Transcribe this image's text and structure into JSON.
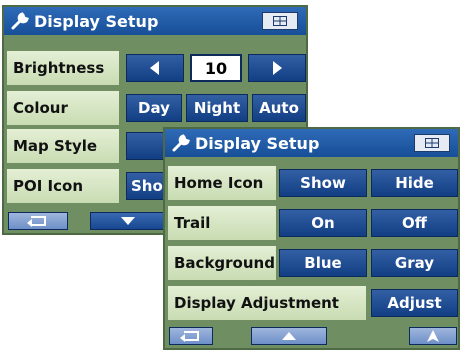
{
  "panel_back": {
    "title": "Display Setup",
    "brightness": {
      "label": "Brightness",
      "value": "10"
    },
    "colour": {
      "label": "Colour",
      "options": [
        "Day",
        "Night",
        "Auto"
      ]
    },
    "map_style": {
      "label": "Map Style"
    },
    "poi_icon": {
      "label": "POI Icon",
      "option_partial": "Sho"
    }
  },
  "panel_front": {
    "title": "Display Setup",
    "home_icon": {
      "label": "Home Icon",
      "options": [
        "Show",
        "Hide"
      ]
    },
    "trail": {
      "label": "Trail",
      "options": [
        "On",
        "Off"
      ]
    },
    "background": {
      "label": "Background",
      "options": [
        "Blue",
        "Gray"
      ]
    },
    "display_adjustment": {
      "label": "Display Adjustment",
      "button": "Adjust"
    }
  },
  "icons": {
    "title": "wrench-icon",
    "keyboard": "keyboard-icon",
    "back": "back-arrow-icon",
    "scroll_down": "chevron-down-icon",
    "scroll_up": "chevron-up-icon",
    "decrease": "arrow-left-icon",
    "increase": "arrow-right-icon"
  },
  "colors": {
    "title_bar": "#1f5aa6",
    "button": "#1f4f96",
    "panel_bg": "#6f8f63",
    "label_bg": "#d6e6c4"
  }
}
